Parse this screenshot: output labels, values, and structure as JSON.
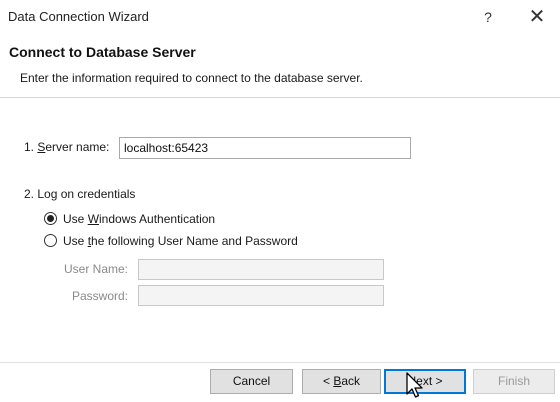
{
  "window": {
    "title": "Data Connection Wizard",
    "help_glyph": "?",
    "close_glyph": "✕"
  },
  "header": {
    "title": "Connect to Database Server",
    "subtitle": "Enter the information required to connect to the database server."
  },
  "server": {
    "label_prefix": "1. ",
    "label_access": "S",
    "label_rest": "erver name:",
    "value": "localhost:65423"
  },
  "credentials": {
    "section_label": "2. Log on credentials",
    "option_windows": {
      "prefix": "Use ",
      "access": "W",
      "rest": "indows Authentication",
      "selected": true
    },
    "option_sql": {
      "prefix": "Use ",
      "access": "t",
      "rest": "he following User Name and Password",
      "selected": false
    },
    "username_label": "User Name:",
    "username_value": "",
    "password_label": "Password:",
    "password_value": ""
  },
  "footer": {
    "cancel_label": "Cancel",
    "back_prefix": "< ",
    "back_access": "B",
    "back_rest": "ack",
    "next_access": "N",
    "next_rest": "ext >",
    "finish_label": "Finish"
  },
  "colors": {
    "accent": "#0078d7",
    "button_face": "#e1e1e1",
    "disabled_text": "#8a8a8a"
  }
}
